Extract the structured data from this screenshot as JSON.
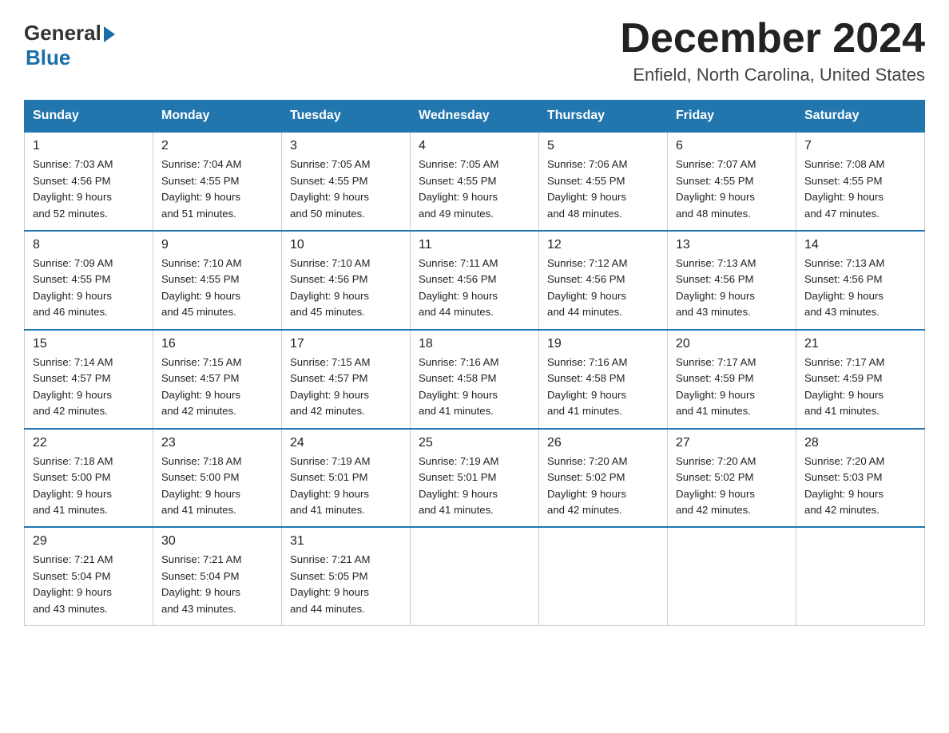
{
  "logo": {
    "general": "General",
    "blue": "Blue"
  },
  "title": "December 2024",
  "location": "Enfield, North Carolina, United States",
  "headers": [
    "Sunday",
    "Monday",
    "Tuesday",
    "Wednesday",
    "Thursday",
    "Friday",
    "Saturday"
  ],
  "weeks": [
    [
      {
        "day": "1",
        "sunrise": "7:03 AM",
        "sunset": "4:56 PM",
        "daylight": "9 hours and 52 minutes."
      },
      {
        "day": "2",
        "sunrise": "7:04 AM",
        "sunset": "4:55 PM",
        "daylight": "9 hours and 51 minutes."
      },
      {
        "day": "3",
        "sunrise": "7:05 AM",
        "sunset": "4:55 PM",
        "daylight": "9 hours and 50 minutes."
      },
      {
        "day": "4",
        "sunrise": "7:05 AM",
        "sunset": "4:55 PM",
        "daylight": "9 hours and 49 minutes."
      },
      {
        "day": "5",
        "sunrise": "7:06 AM",
        "sunset": "4:55 PM",
        "daylight": "9 hours and 48 minutes."
      },
      {
        "day": "6",
        "sunrise": "7:07 AM",
        "sunset": "4:55 PM",
        "daylight": "9 hours and 48 minutes."
      },
      {
        "day": "7",
        "sunrise": "7:08 AM",
        "sunset": "4:55 PM",
        "daylight": "9 hours and 47 minutes."
      }
    ],
    [
      {
        "day": "8",
        "sunrise": "7:09 AM",
        "sunset": "4:55 PM",
        "daylight": "9 hours and 46 minutes."
      },
      {
        "day": "9",
        "sunrise": "7:10 AM",
        "sunset": "4:55 PM",
        "daylight": "9 hours and 45 minutes."
      },
      {
        "day": "10",
        "sunrise": "7:10 AM",
        "sunset": "4:56 PM",
        "daylight": "9 hours and 45 minutes."
      },
      {
        "day": "11",
        "sunrise": "7:11 AM",
        "sunset": "4:56 PM",
        "daylight": "9 hours and 44 minutes."
      },
      {
        "day": "12",
        "sunrise": "7:12 AM",
        "sunset": "4:56 PM",
        "daylight": "9 hours and 44 minutes."
      },
      {
        "day": "13",
        "sunrise": "7:13 AM",
        "sunset": "4:56 PM",
        "daylight": "9 hours and 43 minutes."
      },
      {
        "day": "14",
        "sunrise": "7:13 AM",
        "sunset": "4:56 PM",
        "daylight": "9 hours and 43 minutes."
      }
    ],
    [
      {
        "day": "15",
        "sunrise": "7:14 AM",
        "sunset": "4:57 PM",
        "daylight": "9 hours and 42 minutes."
      },
      {
        "day": "16",
        "sunrise": "7:15 AM",
        "sunset": "4:57 PM",
        "daylight": "9 hours and 42 minutes."
      },
      {
        "day": "17",
        "sunrise": "7:15 AM",
        "sunset": "4:57 PM",
        "daylight": "9 hours and 42 minutes."
      },
      {
        "day": "18",
        "sunrise": "7:16 AM",
        "sunset": "4:58 PM",
        "daylight": "9 hours and 41 minutes."
      },
      {
        "day": "19",
        "sunrise": "7:16 AM",
        "sunset": "4:58 PM",
        "daylight": "9 hours and 41 minutes."
      },
      {
        "day": "20",
        "sunrise": "7:17 AM",
        "sunset": "4:59 PM",
        "daylight": "9 hours and 41 minutes."
      },
      {
        "day": "21",
        "sunrise": "7:17 AM",
        "sunset": "4:59 PM",
        "daylight": "9 hours and 41 minutes."
      }
    ],
    [
      {
        "day": "22",
        "sunrise": "7:18 AM",
        "sunset": "5:00 PM",
        "daylight": "9 hours and 41 minutes."
      },
      {
        "day": "23",
        "sunrise": "7:18 AM",
        "sunset": "5:00 PM",
        "daylight": "9 hours and 41 minutes."
      },
      {
        "day": "24",
        "sunrise": "7:19 AM",
        "sunset": "5:01 PM",
        "daylight": "9 hours and 41 minutes."
      },
      {
        "day": "25",
        "sunrise": "7:19 AM",
        "sunset": "5:01 PM",
        "daylight": "9 hours and 41 minutes."
      },
      {
        "day": "26",
        "sunrise": "7:20 AM",
        "sunset": "5:02 PM",
        "daylight": "9 hours and 42 minutes."
      },
      {
        "day": "27",
        "sunrise": "7:20 AM",
        "sunset": "5:02 PM",
        "daylight": "9 hours and 42 minutes."
      },
      {
        "day": "28",
        "sunrise": "7:20 AM",
        "sunset": "5:03 PM",
        "daylight": "9 hours and 42 minutes."
      }
    ],
    [
      {
        "day": "29",
        "sunrise": "7:21 AM",
        "sunset": "5:04 PM",
        "daylight": "9 hours and 43 minutes."
      },
      {
        "day": "30",
        "sunrise": "7:21 AM",
        "sunset": "5:04 PM",
        "daylight": "9 hours and 43 minutes."
      },
      {
        "day": "31",
        "sunrise": "7:21 AM",
        "sunset": "5:05 PM",
        "daylight": "9 hours and 44 minutes."
      },
      null,
      null,
      null,
      null
    ]
  ]
}
